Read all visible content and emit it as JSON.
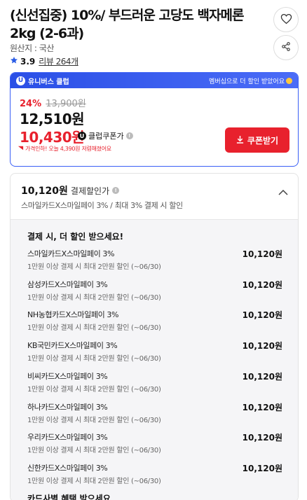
{
  "product": {
    "title": "(신선집중) 10%/ 부드러운 고당도 백자메론 2kg (2-6과)",
    "origin": "원산지 : 국산",
    "rating": "3.9",
    "reviews": "리뷰 264개"
  },
  "icons": {
    "wishlist": "heart-icon",
    "share": "share-icon",
    "star": "star-icon"
  },
  "club": {
    "header_label": "유니버스 클럽",
    "header_promo": "멤버십으로 더 할인 받았어요",
    "discount_pct": "24%",
    "original_price": "13,900원",
    "sale_price": "12,510원",
    "club_price": "10,430원",
    "club_label": "클럽쿠폰가",
    "price_note": "가격인하! 오늘 4,390원 저렴해졌어요",
    "coupon_button": "쿠폰받기"
  },
  "payment": {
    "price": "10,120원",
    "price_label": "결제할인가",
    "summary": "스마일카드X스마일페이 3% / 최대 3% 결제 시 할인",
    "list_title": "결제 시, 더 할인 받으세요!",
    "cards": [
      {
        "name": "스마일카드X스마일페이 3%",
        "desc": "1만원 이상 결제 시 최대 2만원 할인 (~06/30)",
        "price": "10,120원"
      },
      {
        "name": "삼성카드X스마일페이 3%",
        "desc": "1만원 이상 결제 시 최대 2만원 할인 (~06/30)",
        "price": "10,120원"
      },
      {
        "name": "NH농협카드X스마일페이 3%",
        "desc": "1만원 이상 결제 시 최대 2만원 할인 (~06/30)",
        "price": "10,120원"
      },
      {
        "name": "KB국민카드X스마일페이 3%",
        "desc": "1만원 이상 결제 시 최대 2만원 할인 (~06/30)",
        "price": "10,120원"
      },
      {
        "name": "비씨카드X스마일페이 3%",
        "desc": "1만원 이상 결제 시 최대 2만원 할인 (~06/30)",
        "price": "10,120원"
      },
      {
        "name": "하나카드X스마일페이 3%",
        "desc": "1만원 이상 결제 시 최대 2만원 할인 (~06/30)",
        "price": "10,120원"
      },
      {
        "name": "우리카드X스마일페이 3%",
        "desc": "1만원 이상 결제 시 최대 2만원 할인 (~06/30)",
        "price": "10,120원"
      },
      {
        "name": "신한카드X스마일페이 3%",
        "desc": "1만원 이상 결제 시 최대 2만원 할인 (~06/30)",
        "price": "10,120원"
      }
    ],
    "more_text": "카드사별 혜택 받으세요"
  },
  "colors": {
    "accent_red": "#e8212d",
    "club_blue": "#2a4fe6"
  }
}
